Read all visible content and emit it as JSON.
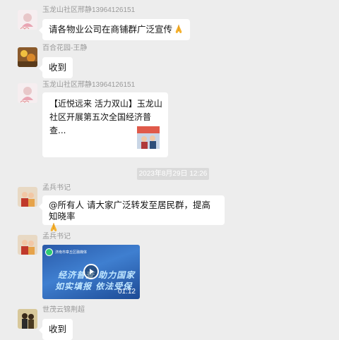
{
  "messages": [
    {
      "sender": "玉龙山社区邢静13964126151",
      "text": "请各物业公司在商铺群广泛宣传"
    },
    {
      "sender": "百合花园-王静",
      "text": "收到"
    },
    {
      "sender": "玉龙山社区邢静13964126151",
      "card_title": "【近悦远来 活力双山】玉龙山社区开展第五次全国经济普查..."
    },
    {
      "sender": "孟兵书记",
      "text": "@所有人 请大家广泛转发至居民群，提高知晓率"
    },
    {
      "sender": "孟兵书记",
      "video_duration": "01:12",
      "video_logo_text": "济南市章丘区融媒体",
      "video_caption_1": "经济普查 助力国家",
      "video_caption_2": "如实填报 依法受保"
    },
    {
      "sender": "世茂云锦荆超",
      "text": "收到"
    }
  ],
  "timestamp": "2023年8月29日 12:26",
  "colors": {
    "background": "#ededed",
    "bubble": "#ffffff",
    "name": "#9a9a9a"
  }
}
